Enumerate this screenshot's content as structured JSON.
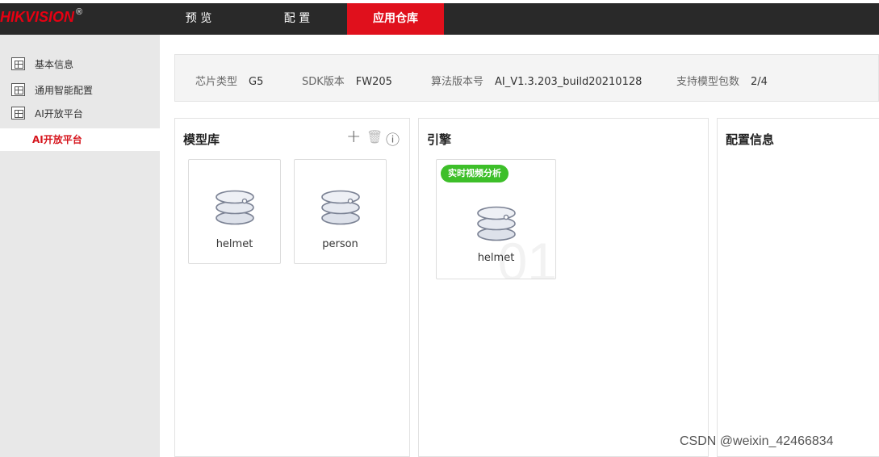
{
  "brand": {
    "logo_text": "HIKVISION",
    "logo_mark": "®"
  },
  "nav": {
    "items": [
      {
        "label": "预 览"
      },
      {
        "label": "配 置"
      },
      {
        "label": "应用仓库"
      }
    ]
  },
  "sidebar": {
    "items": [
      {
        "label": "基本信息",
        "icon": "grid-icon"
      },
      {
        "label": "通用智能配置",
        "icon": "grid-icon"
      },
      {
        "label": "AI开放平台",
        "icon": "grid-icon"
      }
    ],
    "active_sub": "AI开放平台"
  },
  "info": {
    "chip_label": "芯片类型",
    "chip_value": "G5",
    "sdk_label": "SDK版本",
    "sdk_value": "FW205",
    "algo_label": "算法版本号",
    "algo_value": "AI_V1.3.203_build20210128",
    "pkg_label": "支持模型包数",
    "pkg_value": "2/4"
  },
  "model_lib": {
    "title": "模型库",
    "tools": {
      "add": "+",
      "delete": "🗑",
      "info": "ⓘ"
    },
    "cards": [
      {
        "label": "helmet"
      },
      {
        "label": "person"
      }
    ]
  },
  "engine": {
    "title": "引擎",
    "card": {
      "tag": "实时视频分析",
      "label": "helmet",
      "ghost_number": "01"
    }
  },
  "config": {
    "title": "配置信息"
  },
  "watermark": "CSDN @weixin_42466834",
  "colors": {
    "accent_red": "#e0101c",
    "tag_green": "#3dbf29",
    "topbar": "#292929"
  }
}
